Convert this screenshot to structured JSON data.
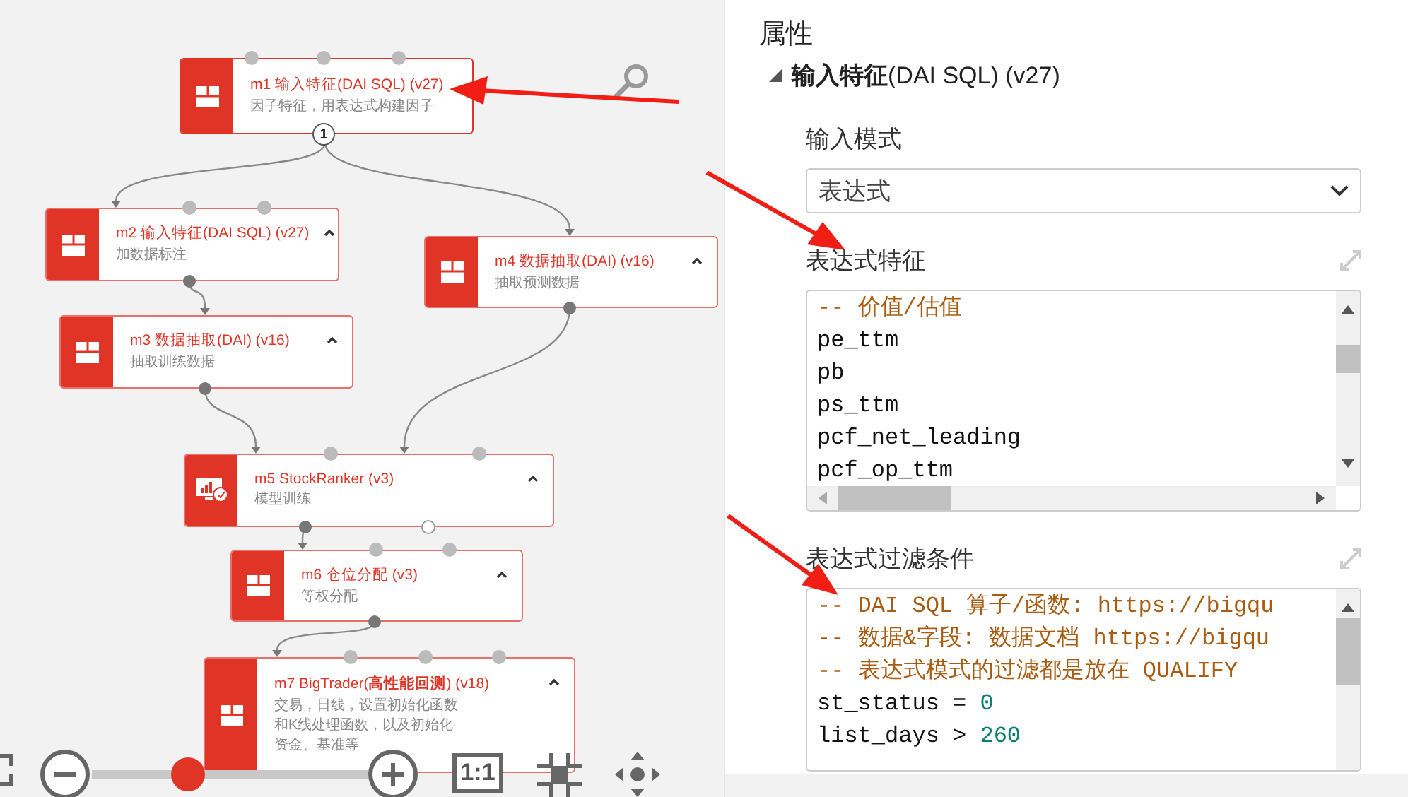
{
  "canvas": {
    "nodes": [
      {
        "title": "m1 输入特征(DAI SQL) (v27)",
        "description": [
          "因子特征，用表达式构建因子"
        ],
        "kind": "table",
        "badge": "1",
        "collapsible": false
      },
      {
        "title": "m2 输入特征(DAI SQL) (v27)",
        "description": [
          "加数据标注"
        ],
        "kind": "table",
        "collapsible": true
      },
      {
        "title": "m3 数据抽取(DAI) (v16)",
        "description": [
          "抽取训练数据"
        ],
        "kind": "table",
        "collapsible": true
      },
      {
        "title": "m4 数据抽取(DAI) (v16)",
        "description": [
          "抽取预测数据"
        ],
        "kind": "table",
        "collapsible": true
      },
      {
        "title": "m5 StockRanker (v3)",
        "description": [
          "模型训练"
        ],
        "kind": "model",
        "collapsible": true
      },
      {
        "title": "m6 仓位分配 (v3)",
        "description": [
          "等权分配"
        ],
        "kind": "table",
        "collapsible": true
      },
      {
        "title": "m7 BigTrader(**高性能回测**) (v18)",
        "description": [
          "交易，日线，设置初始化函数",
          "和K线处理函数，以及初始化",
          "资金、基准等"
        ],
        "kind": "table",
        "collapsible": true
      }
    ],
    "zoom": {
      "level": 0.35,
      "reset_label": "1:1"
    }
  },
  "properties": {
    "title": "属性",
    "module": {
      "heading": "**输入特征**(DAI SQL) (v27)",
      "expanded": true,
      "fields": [
        {
          "kind": "select",
          "label": "输入模式",
          "value": "表达式"
        },
        {
          "kind": "code",
          "label": "表达式特征",
          "expandable": true,
          "horizontal_scroll": true,
          "lines": [
            [
              {
                "t": "-- 价值/估值",
                "kind": "comment"
              }
            ],
            [
              {
                "t": "pe_ttm",
                "kind": "plain"
              }
            ],
            [
              {
                "t": "pb",
                "kind": "plain"
              }
            ],
            [
              {
                "t": "ps_ttm",
                "kind": "plain"
              }
            ],
            [
              {
                "t": "pcf_net_leading",
                "kind": "plain"
              }
            ],
            [
              {
                "t": "pcf_op_ttm",
                "kind": "plain"
              }
            ]
          ]
        },
        {
          "kind": "code",
          "label": "表达式过滤条件",
          "expandable": true,
          "horizontal_scroll": false,
          "lines": [
            [
              {
                "t": "-- DAI SQL 算子/函数: https://bigqu",
                "kind": "comment"
              }
            ],
            [
              {
                "t": "-- 数据&字段: 数据文档 https://bigqu",
                "kind": "comment"
              }
            ],
            [
              {
                "t": "-- 表达式模式的过滤都是放在 QUALIFY",
                "kind": "comment"
              }
            ],
            [
              {
                "t": "st_status = ",
                "kind": "plain"
              },
              {
                "t": "0",
                "kind": "number"
              }
            ],
            [
              {
                "t": "list_days > ",
                "kind": "plain"
              },
              {
                "t": "260",
                "kind": "number"
              }
            ]
          ]
        }
      ]
    }
  }
}
